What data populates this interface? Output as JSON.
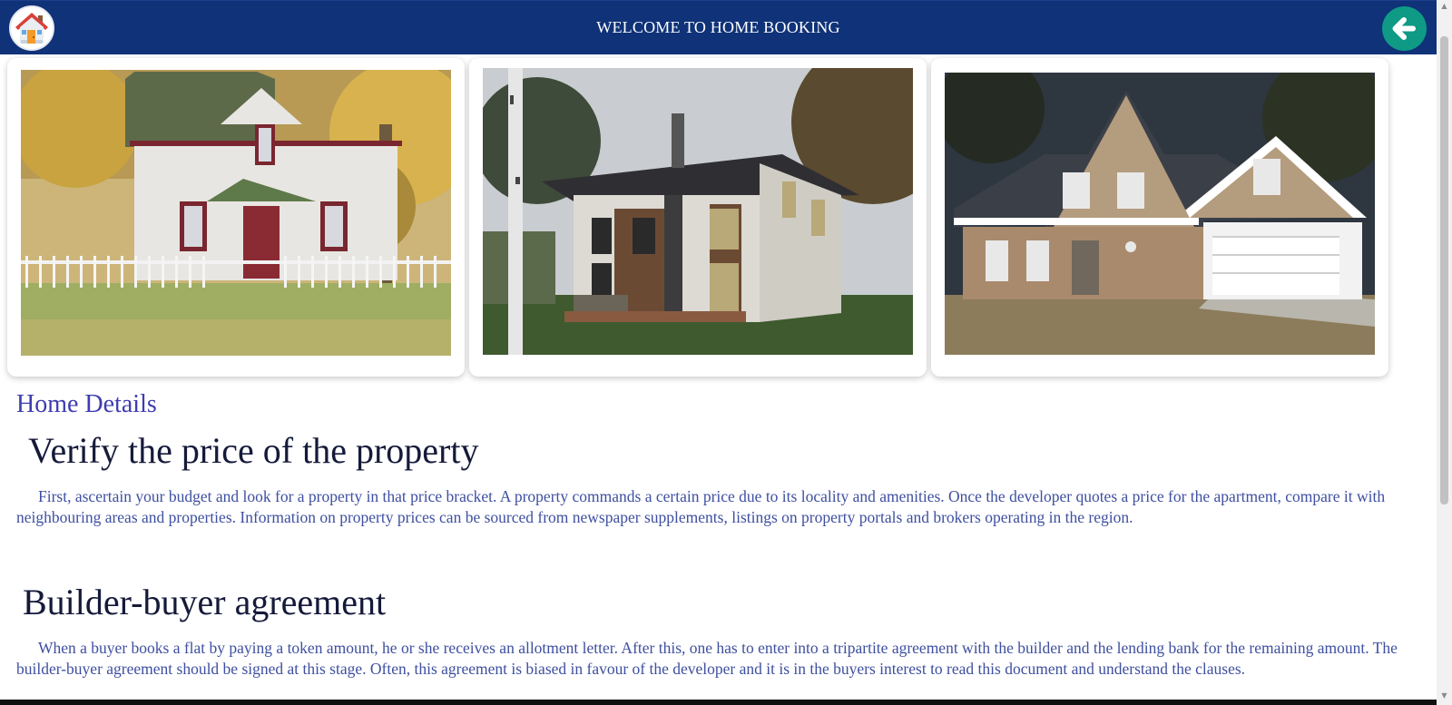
{
  "header": {
    "title": "WELCOME TO HOME BOOKING",
    "home_icon": "house-logo-icon",
    "back_icon": "arrow-left-icon",
    "bar_color": "#0f3278",
    "back_color": "#0f9a86"
  },
  "gallery": [
    {
      "name": "white-farmhouse"
    },
    {
      "name": "modern-two-storey-house"
    },
    {
      "name": "suburban-house-with-garage"
    }
  ],
  "content": {
    "section_label": "Home Details",
    "sections": [
      {
        "heading": "Verify the price of the property",
        "body": "First, ascertain your budget and look for a property in that price bracket. A property commands a certain price due to its locality and amenities. Once the developer quotes a price for the apartment, compare it with neighbouring areas and properties. Information on property prices can be sourced from newspaper supplements, listings on property portals and brokers operating in the region."
      },
      {
        "heading": "Builder-buyer agreement",
        "body": "When a buyer books a flat by paying a token amount, he or she receives an allotment letter. After this, one has to enter into a tripartite agreement with the builder and the lending bank for the remaining amount. The builder-buyer agreement should be signed at this stage. Often, this agreement is biased in favour of the developer and it is in the buyers interest to read this document and understand the clauses."
      }
    ]
  }
}
